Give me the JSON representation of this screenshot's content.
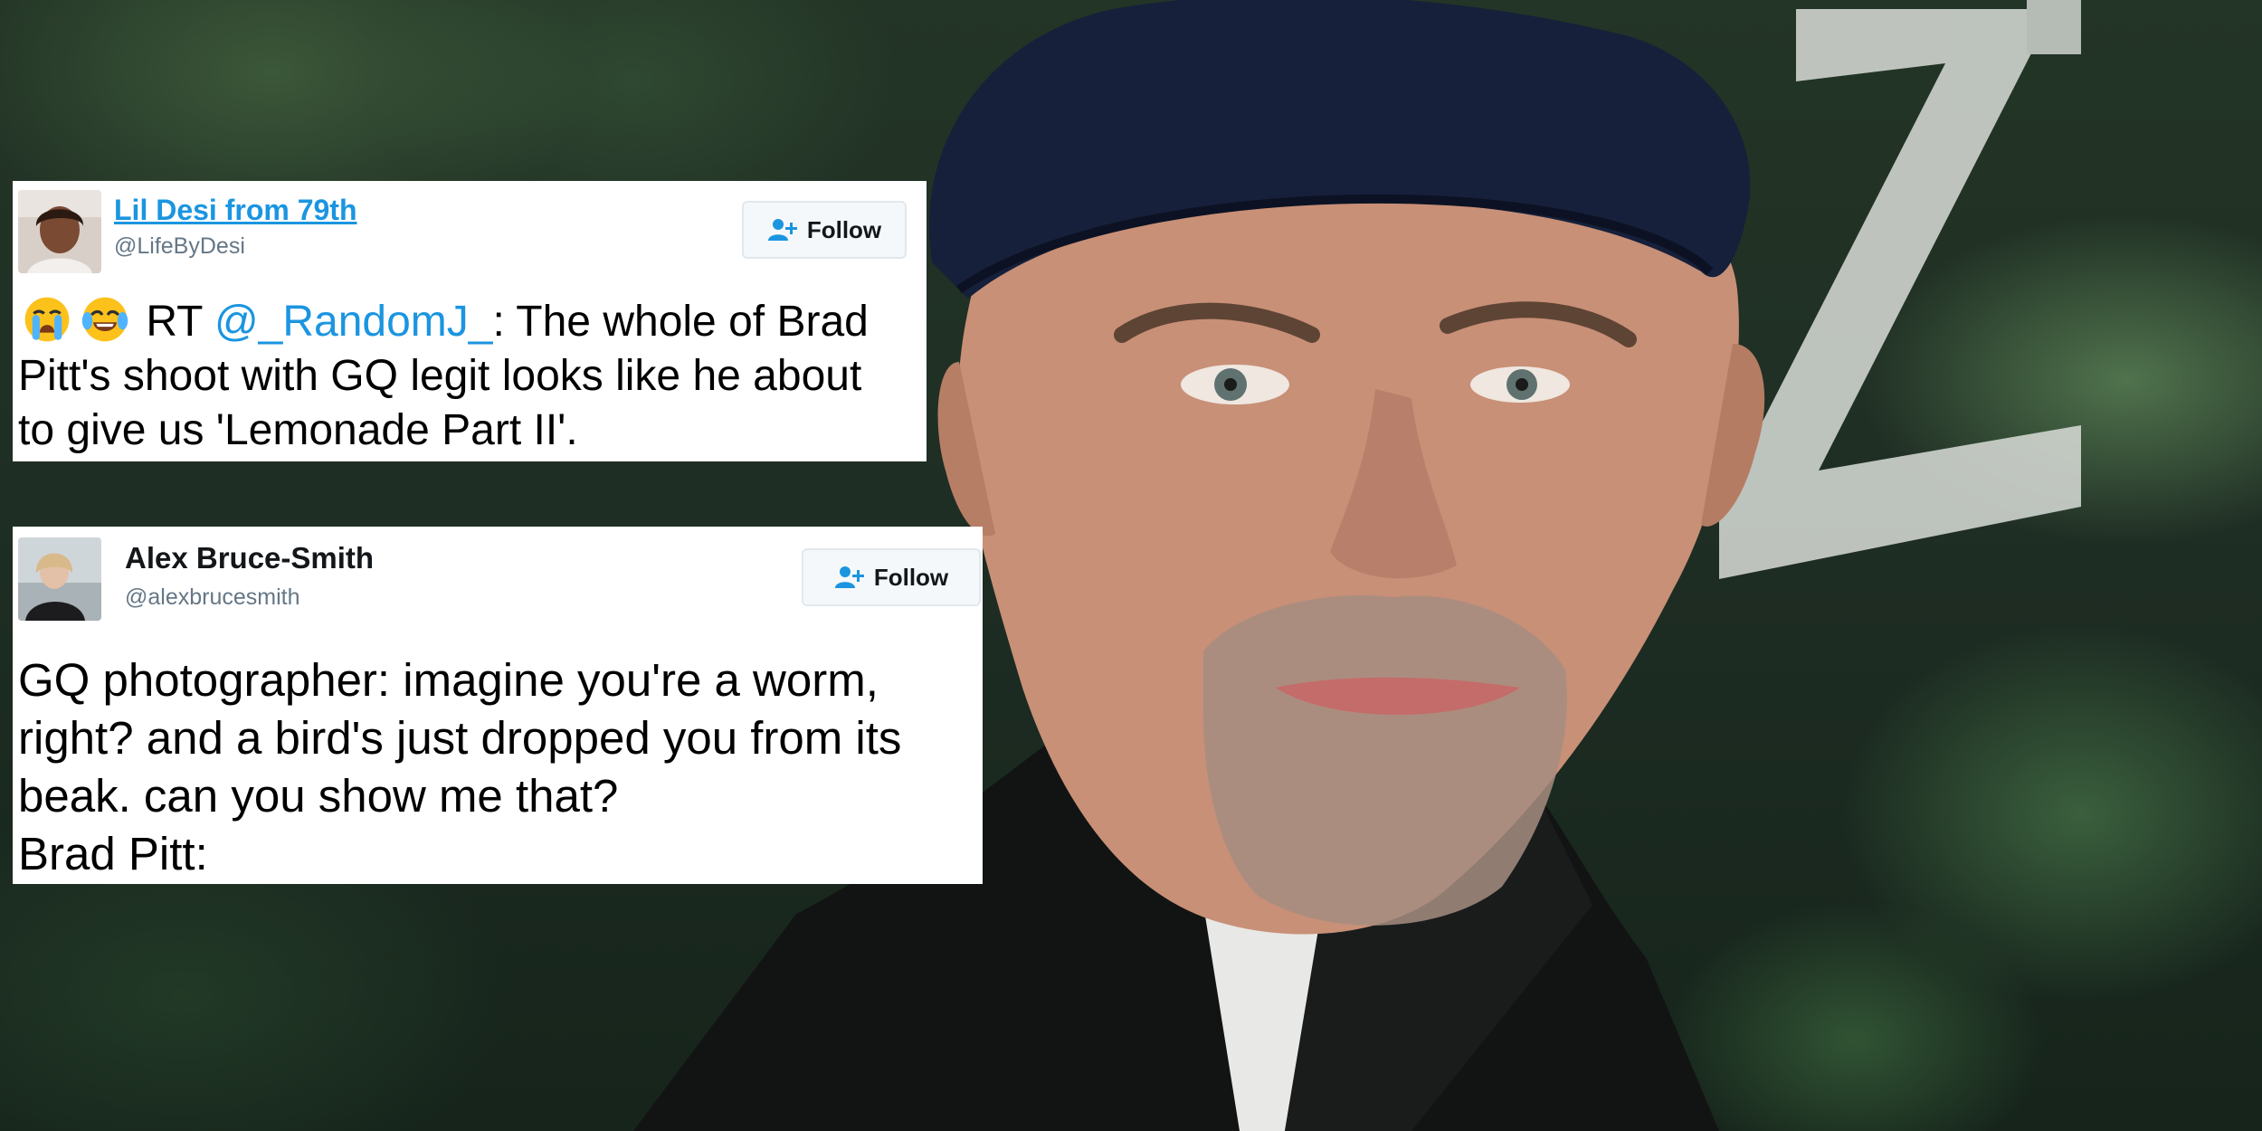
{
  "tweets": [
    {
      "name": "Lil Desi from 79th",
      "handle": "@LifeByDesi",
      "follow_label": "Follow",
      "emojis": [
        "loudly-crying-face",
        "face-with-tears-of-joy"
      ],
      "rt_prefix": "RT",
      "mention": "@_RandomJ_",
      "line1_rest": ": The whole of Brad",
      "line2": "Pitt's shoot with GQ legit looks like he about",
      "line3": "to give us 'Lemonade Part II'."
    },
    {
      "name": "Alex Bruce-Smith",
      "handle": "@alexbrucesmith",
      "follow_label": "Follow",
      "line1": "GQ photographer: imagine you're a worm,",
      "line2": "right? and a bird's just dropped you from its",
      "line3": "beak. can you show me that?",
      "line4": "Brad Pitt:"
    }
  ],
  "colors": {
    "link_blue": "#1b95e0",
    "handle_gray": "#657786",
    "button_bg": "#f5f8fa",
    "button_border": "#e1e8ed"
  },
  "icons": {
    "follow": "add-user-icon"
  }
}
